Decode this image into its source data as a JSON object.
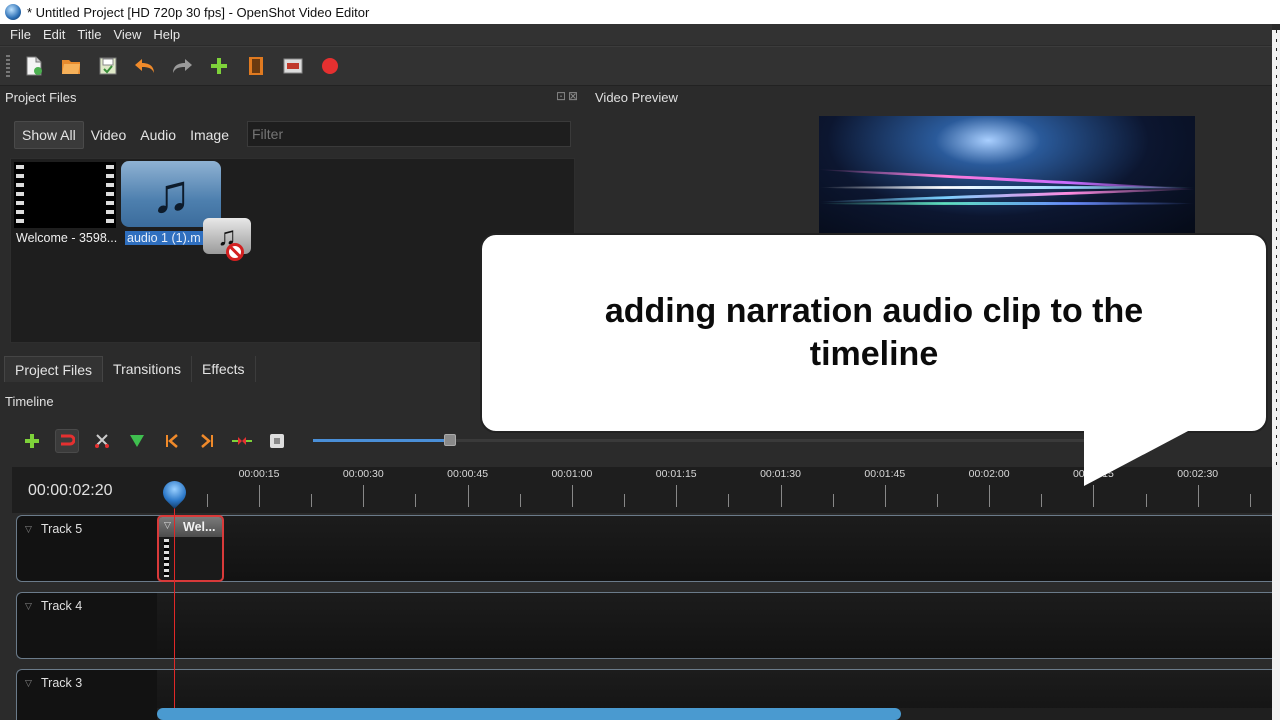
{
  "window": {
    "title": "* Untitled Project [HD 720p 30 fps] - OpenShot Video Editor"
  },
  "menu": [
    "File",
    "Edit",
    "Title",
    "View",
    "Help"
  ],
  "toolbar": {
    "icons": [
      "new-project-icon",
      "open-project-icon",
      "save-project-icon",
      "undo-icon",
      "redo-icon",
      "add-files-icon",
      "export-film-icon",
      "fullscreen-icon",
      "record-icon"
    ]
  },
  "project_files": {
    "title": "Project Files",
    "filters": [
      "Show All",
      "Video",
      "Audio",
      "Image"
    ],
    "filter_placeholder": "Filter",
    "files": [
      {
        "label": "Welcome - 3598...",
        "type": "video"
      },
      {
        "label": "audio 1 (1).m",
        "type": "audio",
        "selected": true
      }
    ]
  },
  "video_preview": {
    "title": "Video Preview"
  },
  "tabs": [
    "Project Files",
    "Transitions",
    "Effects"
  ],
  "timeline": {
    "title": "Timeline",
    "timecode": "00:00:02:20",
    "ruler_labels": [
      "00:00:15",
      "00:00:30",
      "00:00:45",
      "00:01:00",
      "00:01:15",
      "00:01:30",
      "00:01:45",
      "00:02:00",
      "00:02:15",
      "00:02:30"
    ],
    "tracks": [
      "Track 5",
      "Track 4",
      "Track 3"
    ],
    "clip_title": "Wel...",
    "zoom_level": 0.18
  },
  "callout": {
    "text": "adding narration audio clip to the timeline"
  },
  "colors": {
    "accent": "#2f6fbf",
    "playhead": "#e02828",
    "clip_border": "#d93a3a"
  }
}
